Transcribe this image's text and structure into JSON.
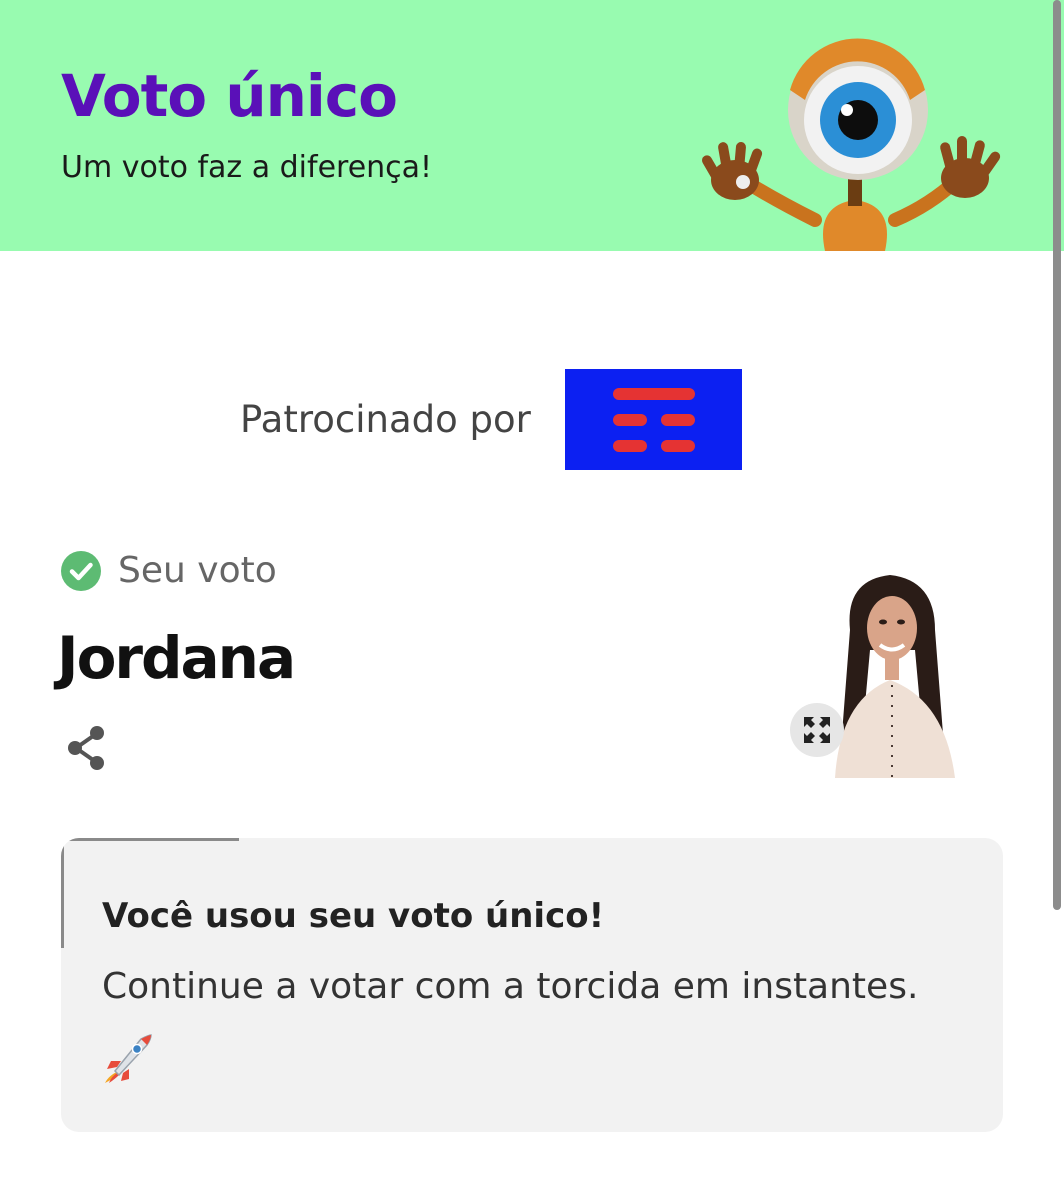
{
  "header": {
    "title": "Voto único",
    "subtitle": "Um voto faz a diferença!",
    "mascot_icon": "big-brother-eye-mascot",
    "background": "#98fbb0",
    "title_color": "#5a10b8"
  },
  "sponsor": {
    "label": "Patrocinado por",
    "logo_icon": "sponsor-logo",
    "logo_colors": [
      "#0c20f2",
      "#e53333"
    ]
  },
  "vote": {
    "status_label": "Seu voto",
    "status_icon": "check-circle-icon",
    "status_color": "#5dbb73",
    "candidate_name": "Jordana",
    "share_icon": "share-icon",
    "expand_icon": "expand-icon"
  },
  "notice": {
    "title": "Você usou seu voto único!",
    "text": "Continue a votar com a torcida em instantes.",
    "emoji_icon": "rocket-icon"
  }
}
